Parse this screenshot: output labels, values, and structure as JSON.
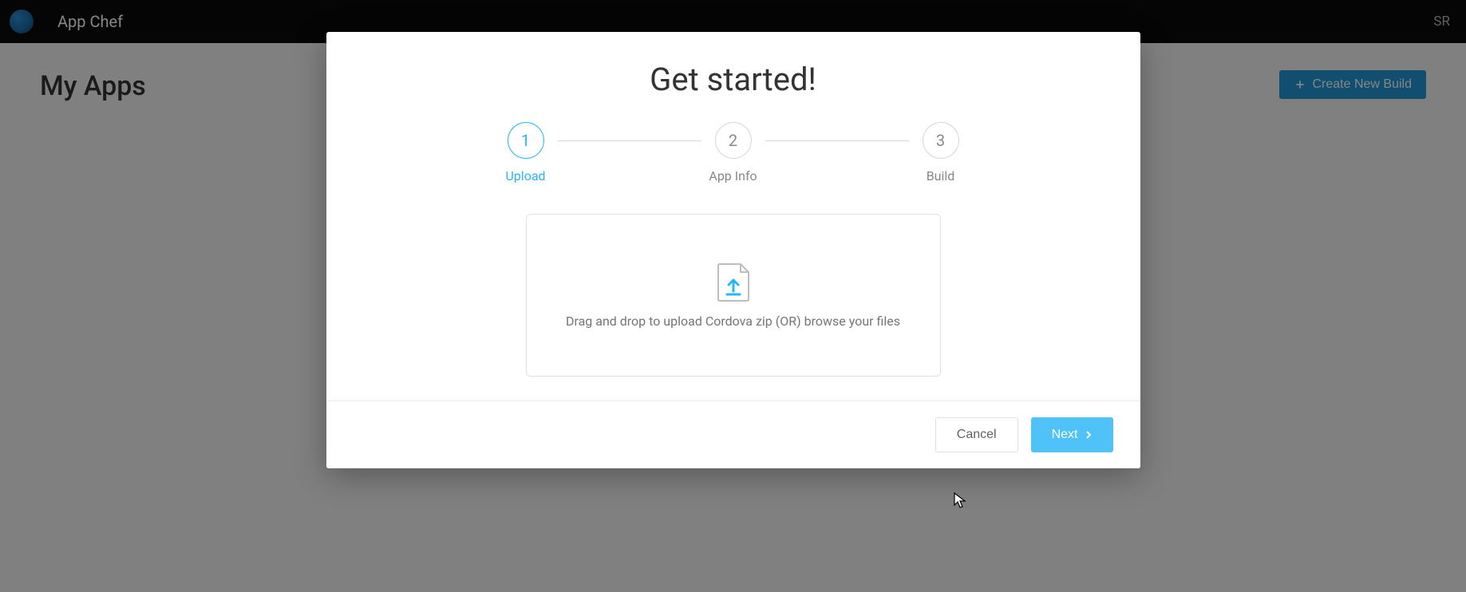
{
  "header": {
    "title": "App Chef",
    "user_initials": "SR"
  },
  "page": {
    "title": "My Apps",
    "create_button": "Create New Build"
  },
  "modal": {
    "title": "Get started!",
    "steps": [
      {
        "num": "1",
        "label": "Upload",
        "active": true
      },
      {
        "num": "2",
        "label": "App Info",
        "active": false
      },
      {
        "num": "3",
        "label": "Build",
        "active": false
      }
    ],
    "dropzone_text": "Drag and drop to upload Cordova zip (OR) browse your files",
    "cancel_label": "Cancel",
    "next_label": "Next"
  }
}
